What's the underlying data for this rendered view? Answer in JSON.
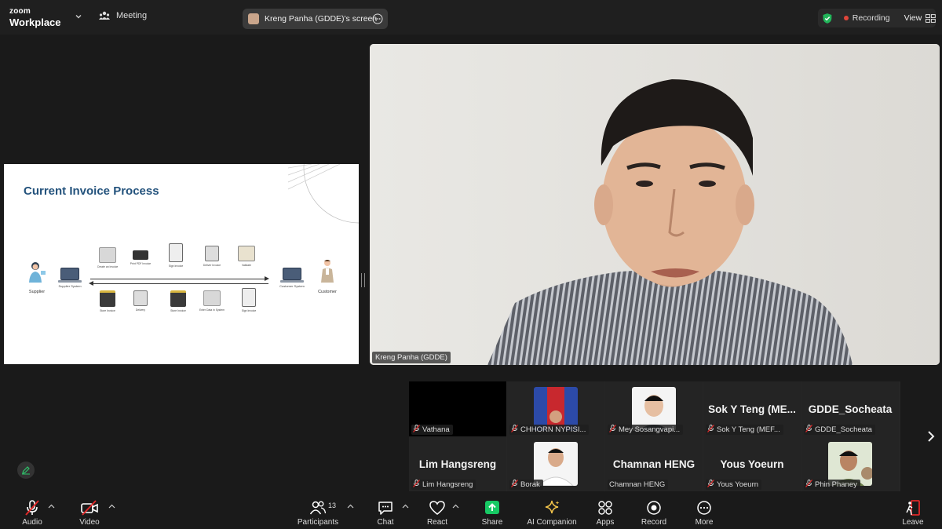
{
  "topbar": {
    "brand_small": "zoom",
    "brand_large": "Workplace",
    "meeting_label": "Meeting",
    "screen_share_label": "Kreng Panha (GDDE)'s screen",
    "recording_label": "Recording",
    "view_label": "View"
  },
  "slide": {
    "title": "Current Invoice Process",
    "supplier": "Supplier",
    "supplier_system": "Supplier System",
    "customer_system": "Customer System",
    "customer": "Customer",
    "top_steps": [
      "Create an Invoice",
      "Print PDF Invoice",
      "Sign Invoice",
      "Deliver Invoice",
      "Validate"
    ],
    "bottom_steps": [
      "Store Invoice",
      "Delivery",
      "Store Invoice",
      "Enter Data in System",
      "Sign Invoice"
    ]
  },
  "speaker": {
    "name": "Kreng Panha (GDDE)"
  },
  "gallery": {
    "tiles": [
      {
        "label": "Vathana",
        "big": "",
        "muted": true
      },
      {
        "label": "CHHORN NYPISI...",
        "big": "",
        "muted": true
      },
      {
        "label": "Mey Sosangvapi...",
        "big": "",
        "muted": true
      },
      {
        "label": "Sok Y Teng (MEF...",
        "big": "Sok Y Teng (ME...",
        "muted": true
      },
      {
        "label": "GDDE_Socheata",
        "big": "GDDE_Socheata",
        "muted": true
      },
      {
        "label": "Lim Hangsreng",
        "big": "Lim Hangsreng",
        "muted": true
      },
      {
        "label": "Borak",
        "big": "",
        "muted": true
      },
      {
        "label": "Chamnan HENG",
        "big": "Chamnan HENG",
        "muted": false
      },
      {
        "label": "Yous Yoeurn",
        "big": "Yous Yoeurn",
        "muted": true
      },
      {
        "label": "Phin Phaney",
        "big": "",
        "muted": true
      }
    ]
  },
  "toolbar": {
    "audio": "Audio",
    "video": "Video",
    "participants": "Participants",
    "participants_count": "13",
    "chat": "Chat",
    "react": "React",
    "share": "Share",
    "ai_companion": "AI Companion",
    "apps": "Apps",
    "record": "Record",
    "more": "More",
    "leave": "Leave"
  },
  "colors": {
    "background": "#1a1a1a",
    "recording_dot": "#e0453a",
    "share_green": "#17c964",
    "leave_red": "#e02828",
    "slide_title": "#23527c"
  }
}
